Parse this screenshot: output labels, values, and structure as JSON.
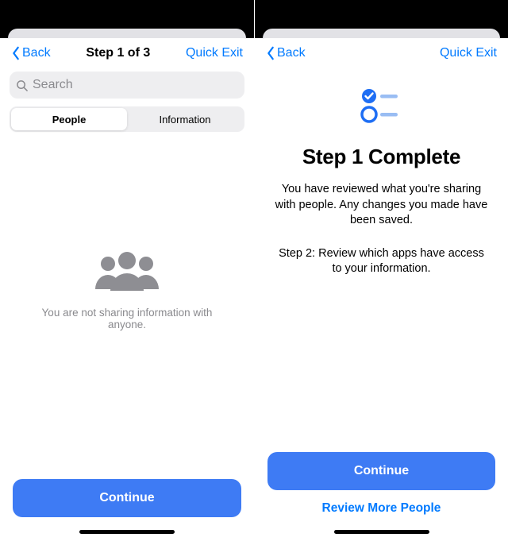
{
  "colors": {
    "accent": "#007aff",
    "button": "#3e7bf4",
    "muted": "#8a8a8e",
    "segmentBg": "#eeeef0"
  },
  "left": {
    "nav": {
      "back": "Back",
      "title": "Step 1 of 3",
      "quickExit": "Quick Exit"
    },
    "search": {
      "placeholder": "Search"
    },
    "tabs": {
      "people": "People",
      "information": "Information"
    },
    "emptyText": "You are not sharing information with anyone.",
    "continue": "Continue"
  },
  "right": {
    "nav": {
      "back": "Back",
      "quickExit": "Quick Exit"
    },
    "title": "Step 1 Complete",
    "body": "You have reviewed what you're sharing with people. Any changes you made have been saved.",
    "nextStep": "Step 2: Review which apps have access to your information.",
    "continue": "Continue",
    "reviewMore": "Review More People"
  }
}
